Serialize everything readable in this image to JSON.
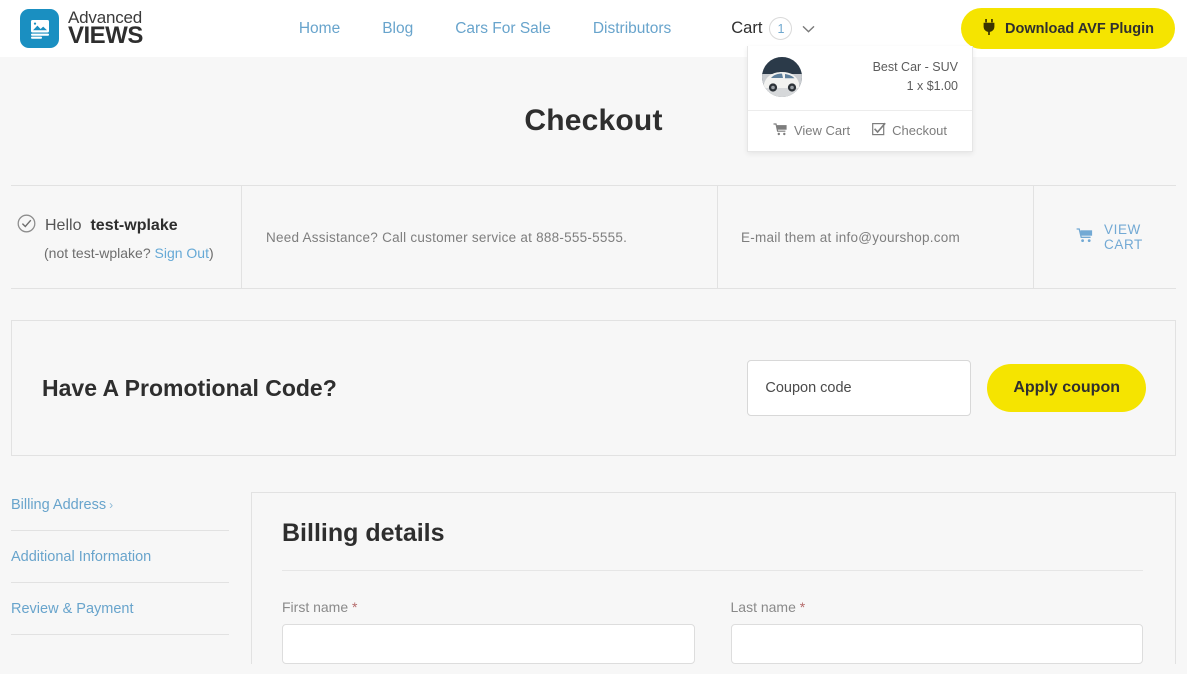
{
  "header": {
    "brand": {
      "top": "Advanced",
      "bottom": "VIEWS",
      "icon": "image-card-icon"
    },
    "nav": [
      {
        "label": "Home"
      },
      {
        "label": "Blog"
      },
      {
        "label": "Cars For Sale"
      },
      {
        "label": "Distributors"
      }
    ],
    "cart": {
      "label": "Cart",
      "count": "1",
      "chevron": "⌄"
    },
    "plugin_button": {
      "label": "Download AVF Plugin",
      "icon": "plug-icon"
    }
  },
  "cart_dropdown": {
    "item": {
      "name": "Best Car - SUV",
      "price": "1 x $1.00",
      "thumb_alt": "car-thumbnail"
    },
    "actions": [
      {
        "label": "View Cart",
        "icon": "cart-icon"
      },
      {
        "label": "Checkout",
        "icon": "check-square-icon"
      }
    ]
  },
  "page": {
    "title": "Checkout"
  },
  "infobar": {
    "greeting_prefix": "Hello",
    "username": "test-wplake",
    "not_you_prefix": "(not test-wplake?",
    "sign_out": "Sign Out",
    "not_you_suffix": ")",
    "phone_text": "Need Assistance? Call customer service at 888-555-5555.",
    "email_text": "E-mail them at info@yourshop.com",
    "view_cart": "VIEW CART"
  },
  "coupon": {
    "title": "Have A Promotional Code?",
    "placeholder": "Coupon code",
    "value": "",
    "apply_label": "Apply coupon"
  },
  "steps": [
    {
      "label": "Billing Address",
      "caret": "›"
    },
    {
      "label": "Additional Information",
      "caret": ""
    },
    {
      "label": "Review & Payment",
      "caret": ""
    }
  ],
  "billing": {
    "title": "Billing details",
    "fields": [
      {
        "label": "First name",
        "required": "*",
        "value": ""
      },
      {
        "label": "Last name",
        "required": "*",
        "value": ""
      }
    ]
  },
  "colors": {
    "accent_yellow": "#f5e400",
    "link_blue": "#68a4cc",
    "brand_teal": "#1a8fc1",
    "page_bg": "#f7f7f7"
  }
}
